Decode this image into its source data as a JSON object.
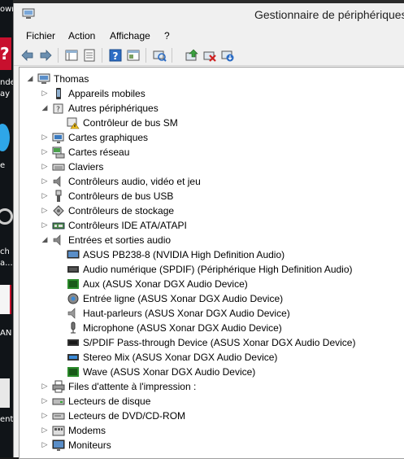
{
  "desktop": {
    "top_text": "own",
    "labels": [
      "nde",
      "ay",
      "e",
      "ch",
      "a...",
      "AN",
      "ent"
    ]
  },
  "window": {
    "title": "Gestionnaire de périphériques"
  },
  "menu": [
    "Fichier",
    "Action",
    "Affichage",
    "?"
  ],
  "toolbar": {
    "icons": [
      "back-icon",
      "forward-icon",
      "show-hide-tree-icon",
      "properties-icon",
      "help-icon",
      "view-icon",
      "scan-hardware-icon",
      "update-driver-icon",
      "uninstall-icon",
      "disable-device-icon"
    ]
  },
  "tree": {
    "root": "Thomas",
    "rows": [
      {
        "label": "Appareils mobiles",
        "level": 1,
        "arrow": "collapsed",
        "icon": "mobile-device-icon"
      },
      {
        "label": "Autres périphériques",
        "level": 1,
        "arrow": "expanded",
        "icon": "unknown-device-icon"
      },
      {
        "label": "Contrôleur de bus SM",
        "level": 2,
        "arrow": "none",
        "icon": "warning-device-icon"
      },
      {
        "label": "Cartes graphiques",
        "level": 1,
        "arrow": "collapsed",
        "icon": "display-adapter-icon"
      },
      {
        "label": "Cartes réseau",
        "level": 1,
        "arrow": "collapsed",
        "icon": "network-adapter-icon"
      },
      {
        "label": "Claviers",
        "level": 1,
        "arrow": "collapsed",
        "icon": "keyboard-icon"
      },
      {
        "label": "Contrôleurs audio, vidéo et jeu",
        "level": 1,
        "arrow": "collapsed",
        "icon": "audio-controller-icon"
      },
      {
        "label": "Contrôleurs de bus USB",
        "level": 1,
        "arrow": "collapsed",
        "icon": "usb-icon"
      },
      {
        "label": "Contrôleurs de stockage",
        "level": 1,
        "arrow": "collapsed",
        "icon": "storage-controller-icon"
      },
      {
        "label": "Contrôleurs IDE ATA/ATAPI",
        "level": 1,
        "arrow": "collapsed",
        "icon": "ide-controller-icon"
      },
      {
        "label": "Entrées et sorties audio",
        "level": 1,
        "arrow": "expanded",
        "icon": "audio-io-icon"
      },
      {
        "label": "ASUS PB238-8 (NVIDIA High Definition Audio)",
        "level": 2,
        "arrow": "none",
        "icon": "monitor-audio-icon"
      },
      {
        "label": "Audio numérique (SPDIF) (Périphérique High Definition Audio)",
        "level": 2,
        "arrow": "none",
        "icon": "spdif-icon"
      },
      {
        "label": "Aux (ASUS Xonar DGX Audio Device)",
        "level": 2,
        "arrow": "none",
        "icon": "aux-icon"
      },
      {
        "label": "Entrée ligne (ASUS Xonar DGX Audio Device)",
        "level": 2,
        "arrow": "none",
        "icon": "line-in-icon"
      },
      {
        "label": "Haut-parleurs (ASUS Xonar DGX Audio Device)",
        "level": 2,
        "arrow": "none",
        "icon": "speaker-icon"
      },
      {
        "label": "Microphone (ASUS Xonar DGX Audio Device)",
        "level": 2,
        "arrow": "none",
        "icon": "microphone-icon"
      },
      {
        "label": "S/PDIF Pass-through Device (ASUS Xonar DGX Audio Device)",
        "level": 2,
        "arrow": "none",
        "icon": "spdif-pass-icon"
      },
      {
        "label": "Stereo Mix (ASUS Xonar DGX Audio Device)",
        "level": 2,
        "arrow": "none",
        "icon": "stereo-mix-icon"
      },
      {
        "label": "Wave (ASUS Xonar DGX Audio Device)",
        "level": 2,
        "arrow": "none",
        "icon": "wave-icon"
      },
      {
        "label": "Files d'attente à l'impression :",
        "level": 1,
        "arrow": "collapsed",
        "icon": "printer-icon"
      },
      {
        "label": "Lecteurs de disque",
        "level": 1,
        "arrow": "collapsed",
        "icon": "disk-drive-icon"
      },
      {
        "label": "Lecteurs de DVD/CD-ROM",
        "level": 1,
        "arrow": "collapsed",
        "icon": "dvd-drive-icon"
      },
      {
        "label": "Modems",
        "level": 1,
        "arrow": "collapsed",
        "icon": "modem-icon"
      },
      {
        "label": "Moniteurs",
        "level": 1,
        "arrow": "collapsed",
        "icon": "monitor-icon"
      }
    ]
  },
  "colors": {
    "window_bg": "#f0f0f0",
    "tree_bg": "#ffffff",
    "desktop_bg": "#101418"
  }
}
